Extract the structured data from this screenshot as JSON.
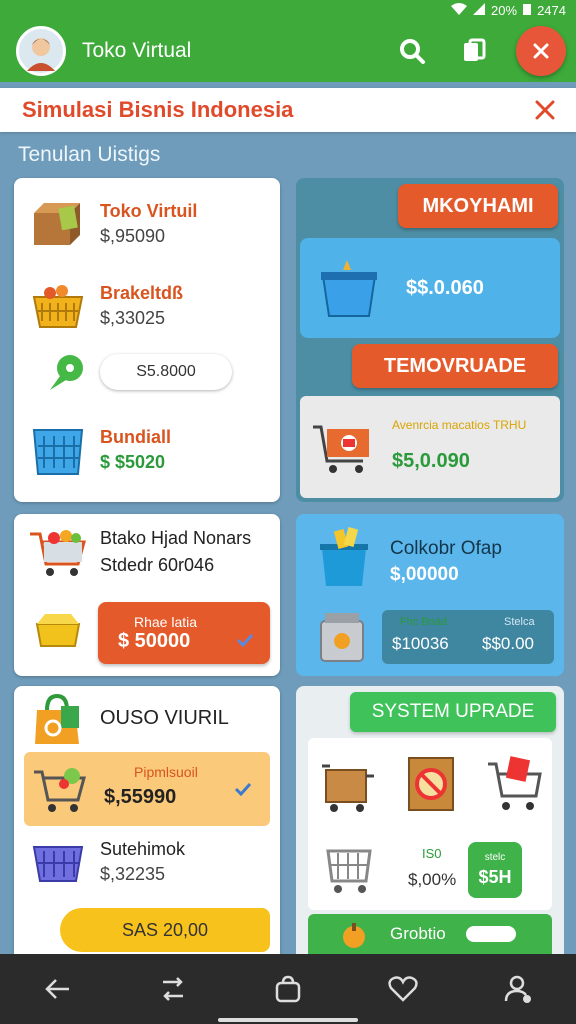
{
  "status": {
    "battery": "20%",
    "time": "2474"
  },
  "app": {
    "title": "Toko Virtual"
  },
  "banner": {
    "title": "Simulasi Bisnis Indonesia"
  },
  "section": {
    "title": "Tenulan Uistigs"
  },
  "left": {
    "c1": {
      "i1": {
        "name": "Toko Virtuil",
        "price": "$,95090"
      },
      "i2": {
        "name": "Brakeltdß",
        "price": "$,33025"
      },
      "btn": "S5.8000",
      "i3": {
        "name": "Bundiall",
        "price": "$ $5020"
      }
    },
    "c2": {
      "line1": "Btako Hjad Nonars",
      "line2": "Stdedr 60r046",
      "btn_label": "Rhae latia",
      "btn_value": "$ 50000"
    },
    "c3": {
      "title": "OUSO VIURIL",
      "h_label": "Pipmlsuoil",
      "h_price": "$,55990",
      "i2": {
        "name": "Sutehimok",
        "price": "$,32235"
      },
      "btn": "SAS 20,00"
    }
  },
  "right": {
    "p1": {
      "btn1": "MKOYHAMI",
      "tile1": "$$.0.060",
      "btn2": "TEMOVRUADE",
      "card_sub": "Avenrcia macatios TRHU",
      "card_value": "$5,0.090"
    },
    "p2": {
      "title": "Colkobr Ofap",
      "value": "$,00000",
      "box_l_label": "Fhc Bnad",
      "box_l_value": "$10036",
      "box_r_label": "Stelca",
      "box_r_value": "$$0.00"
    },
    "p3": {
      "btn": "SYSTEM UPRADE",
      "mid_label": "IS0",
      "mid_value": "$,00%",
      "badge_top": "stelc",
      "badge_val": "$5H",
      "bottom": "Grobtio"
    }
  }
}
